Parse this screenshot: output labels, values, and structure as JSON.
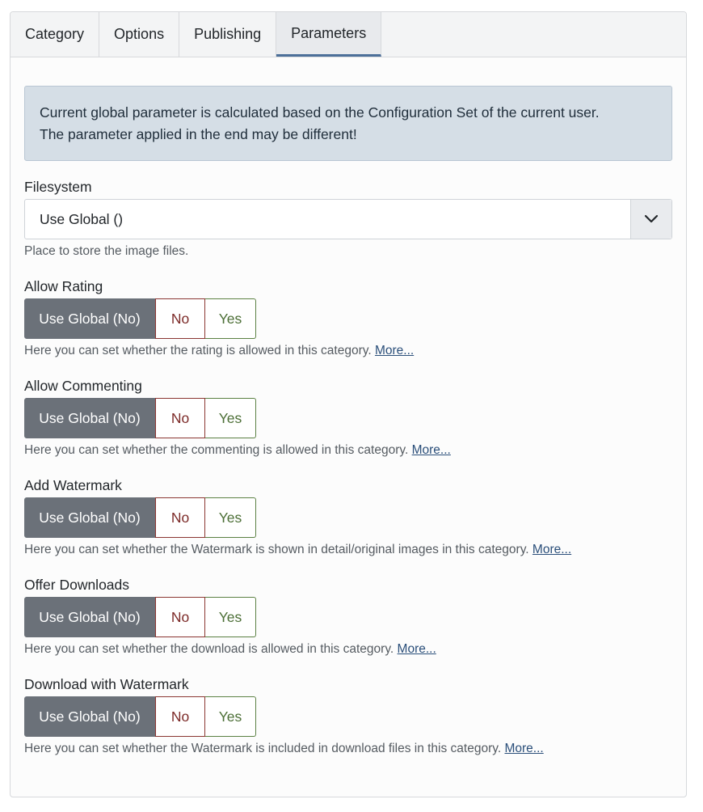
{
  "tabs": [
    {
      "label": "Category"
    },
    {
      "label": "Options"
    },
    {
      "label": "Publishing"
    },
    {
      "label": "Parameters"
    }
  ],
  "alert": {
    "line1": "Current global parameter is calculated based on the Configuration Set of the current user.",
    "line2": "The parameter applied in the end may be different!"
  },
  "filesystem": {
    "label": "Filesystem",
    "value": "Use Global ()",
    "help": "Place to store the image files."
  },
  "buttons": {
    "global": "Use Global (No)",
    "no": "No",
    "yes": "Yes"
  },
  "more_link": "More...",
  "fields": [
    {
      "label": "Allow Rating",
      "help": "Here you can set whether the rating is allowed in this category."
    },
    {
      "label": "Allow Commenting",
      "help": "Here you can set whether the commenting is allowed in this category."
    },
    {
      "label": "Add Watermark",
      "help": "Here you can set whether the Watermark is shown in detail/original images in this category."
    },
    {
      "label": "Offer Downloads",
      "help": "Here you can set whether the download is allowed in this category."
    },
    {
      "label": "Download with Watermark",
      "help": "Here you can set whether the Watermark is included in download files in this category."
    }
  ],
  "colors": {
    "active_tab_border": "#4c6f99",
    "global_button": "#6b7179",
    "no_button": "#7c2a28",
    "yes_button": "#4b6e35"
  }
}
